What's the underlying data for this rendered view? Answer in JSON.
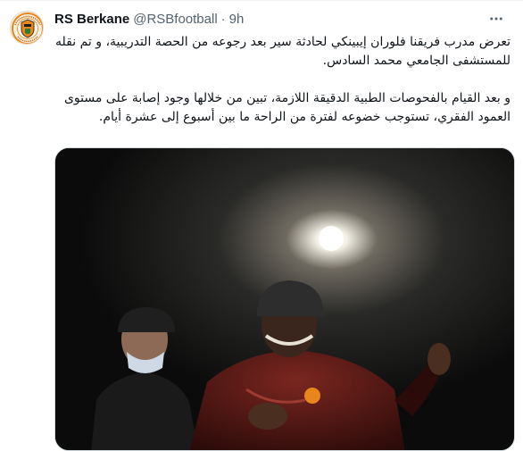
{
  "tweet": {
    "author_name": "RS Berkane",
    "author_handle": "@RSBfootball",
    "separator": "·",
    "time": "9h",
    "paragraphs": [
      "تعرض مدرب فريقنا فلوران إيبينكي لحادثة سير بعد رجوعه من الحصة التدريبية، و تم نقله للمستشفى الجامعي محمد السادس.",
      "و بعد القيام بالفحوصات الطبية الدقيقة اللازمة، تبين من خلالها وجود إصابة على مستوى العمود الفقري، تستوجب خضوعه لفترة من الراحة ما بين أسبوع إلى عشرة أيام."
    ],
    "avatar_logo_text_top": "RENAISSANCE SPORTIVE",
    "avatar_logo_text_bottom": "BERKANE"
  },
  "icons": {
    "more": "more-horizontal-icon"
  },
  "colors": {
    "brand_orange": "#e8851d",
    "text_primary": "#0f1419",
    "text_secondary": "#536471",
    "border": "#cfd9de"
  }
}
